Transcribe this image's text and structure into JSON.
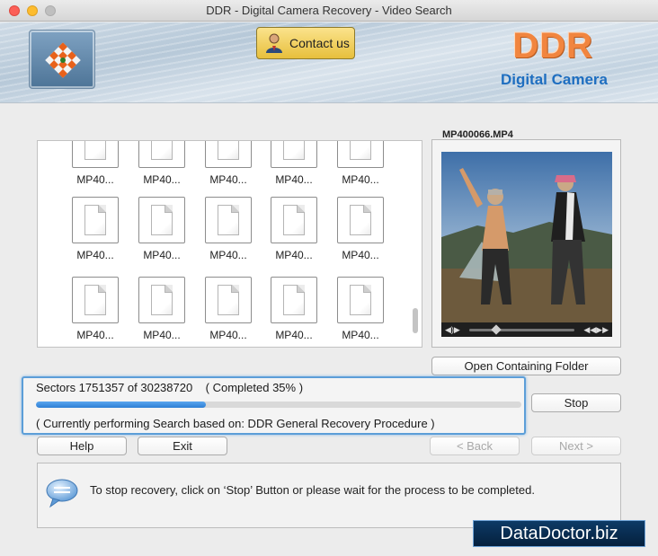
{
  "window": {
    "title": "DDR - Digital Camera Recovery - Video Search"
  },
  "header": {
    "contact_label": "Contact us",
    "brand_title": "DDR",
    "brand_subtitle": "Digital Camera"
  },
  "files": [
    "MP40...",
    "MP40...",
    "MP40...",
    "MP40...",
    "MP40...",
    "MP40...",
    "MP40...",
    "MP40...",
    "MP40...",
    "MP40...",
    "MP40...",
    "MP40...",
    "MP40...",
    "MP40...",
    "MP40..."
  ],
  "preview": {
    "filename": "MP400066.MP4",
    "open_folder_label": "Open Containing Folder"
  },
  "progress": {
    "sectors_text": "Sectors 1751357 of 30238720",
    "completed_text": "( Completed 35% )",
    "fraction": 0.35,
    "status_text": "( Currently performing Search based on: DDR General Recovery Procedure )"
  },
  "buttons": {
    "stop": "Stop",
    "help": "Help",
    "exit": "Exit",
    "back": "< Back",
    "next": "Next >"
  },
  "info": {
    "message": "To stop recovery, click on ‘Stop’ Button or please wait for the process to be completed."
  },
  "watermark": "DataDoctor.biz",
  "colors": {
    "accent": "#2f7fd4",
    "brand": "#f1853f",
    "brand_sub": "#1e6ec0"
  },
  "icons": {
    "logo": "checker-logo-icon",
    "contact": "person-icon",
    "info": "speech-bubble-icon"
  }
}
